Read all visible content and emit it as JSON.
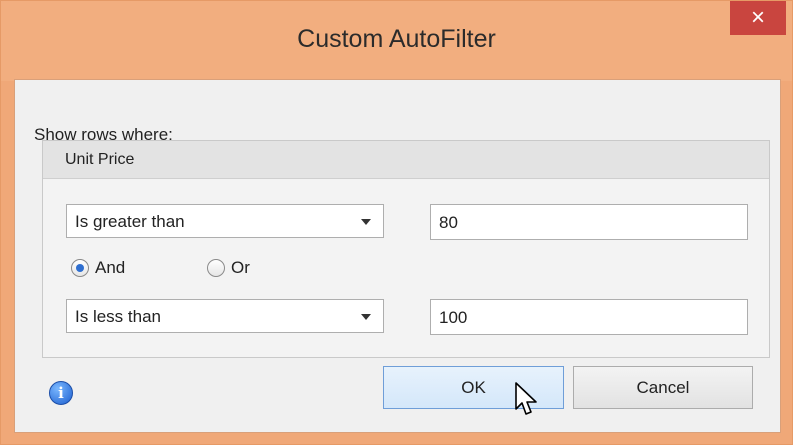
{
  "window": {
    "title": "Custom AutoFilter",
    "close_symbol": "×"
  },
  "filter": {
    "show_rows_label": "Show rows where:",
    "field_name": "Unit Price",
    "condition1": {
      "operator": "Is greater than",
      "value": "80"
    },
    "logic": {
      "and_label": "And",
      "or_label": "Or",
      "selected": "And"
    },
    "condition2": {
      "operator": "Is less than",
      "value": "100"
    }
  },
  "buttons": {
    "ok_label": "OK",
    "cancel_label": "Cancel"
  },
  "icons": {
    "info": "info-icon",
    "info_glyph": "i",
    "cursor": "mouse-pointer-icon"
  },
  "colors": {
    "titlebar": "#f2ae7f",
    "close_button": "#c9453f",
    "dialog_background": "#f0f0f0",
    "ok_button_border": "#6f9ed8",
    "radio_checked": "#2f6fd0"
  }
}
